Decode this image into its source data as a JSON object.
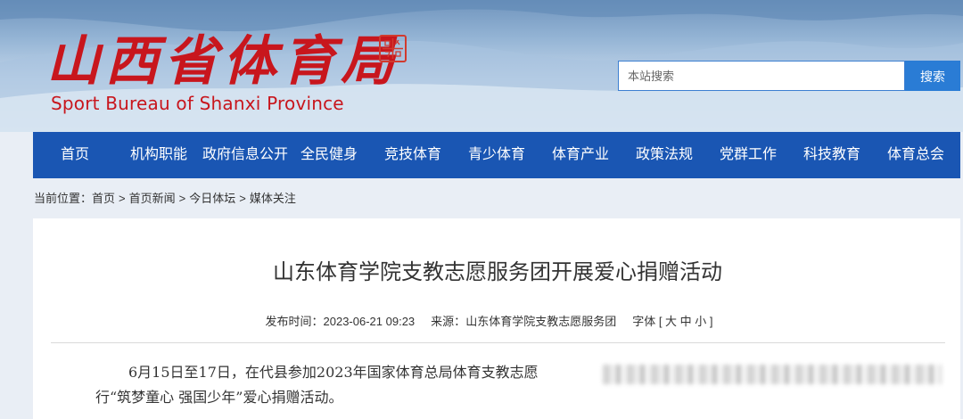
{
  "header": {
    "logo_cn": "山西省体育局",
    "logo_en": "Sport Bureau of Shanxi Province",
    "search_placeholder": "本站搜索",
    "search_button": "搜索"
  },
  "nav": {
    "items": [
      "首页",
      "机构职能",
      "政府信息公开",
      "全民健身",
      "竞技体育",
      "青少体育",
      "体育产业",
      "政策法规",
      "党群工作",
      "科技教育",
      "体育总会"
    ]
  },
  "breadcrumb": {
    "label": "当前位置：",
    "items": [
      "首页",
      "首页新闻",
      "今日体坛",
      "媒体关注"
    ],
    "separator": ">"
  },
  "article": {
    "title": "山东体育学院支教志愿服务团开展爱心捐赠活动",
    "published_label": "发布时间：",
    "published_value": "2023-06-21 09:23",
    "source_label": "来源：",
    "source_value": "山东体育学院支教志愿服务团",
    "font_size_label": "字体 [ 大 中 小 ]",
    "body_line1": "6月15日至17日，在代县参加2023年国家体育总局体育支教志愿",
    "body_line2": "行“筑梦童心 强国少年”爱心捐赠活动。"
  },
  "colors": {
    "nav_bg": "#1a56b3",
    "search_button_bg": "#2a7cd5",
    "logo_red": "#c8161d"
  }
}
